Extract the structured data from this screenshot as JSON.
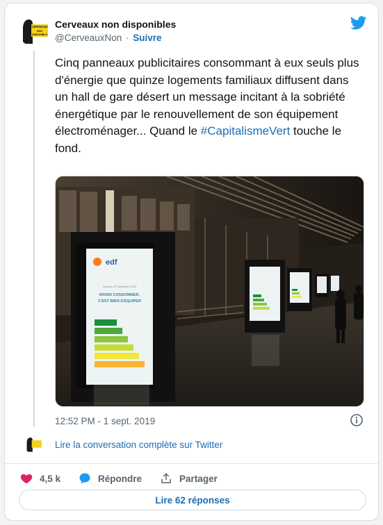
{
  "author": {
    "name": "Cerveaux non disponibles",
    "handle": "@CerveauxNon",
    "separator": "·",
    "follow_label": "Suivre",
    "avatar_text": "CERVEAUX DISPONIBLE"
  },
  "tweet": {
    "text_before": "Cinq panneaux publicitaires consommant à eux seuls plus d'énergie que quinze logements familiaux diffusent dans un hall de gare désert un message incitant à la sobriété énergétique par le renouvellement de son équipement électroménager... Quand le ",
    "hashtag": "#CapitalismeVert",
    "text_after": " touche le fond.",
    "timestamp": "12:52 PM - 1 sept. 2019"
  },
  "media": {
    "ad_brand": "edf",
    "ad_date": "Jusqu'au 27 septembre 2019",
    "ad_headline": "MOINS CONSOMMER, C'EST BIEN S'ÉQUIPER"
  },
  "conversation": {
    "link_label": "Lire la conversation complète sur Twitter"
  },
  "actions": {
    "like_count": "4,5 k",
    "reply_label": "Répondre",
    "share_label": "Partager"
  },
  "replies": {
    "button_label": "Lire 62 réponses"
  },
  "colors": {
    "accent": "#1b6db5",
    "like": "#e0245e",
    "twitter_blue": "#1d9bf0"
  }
}
